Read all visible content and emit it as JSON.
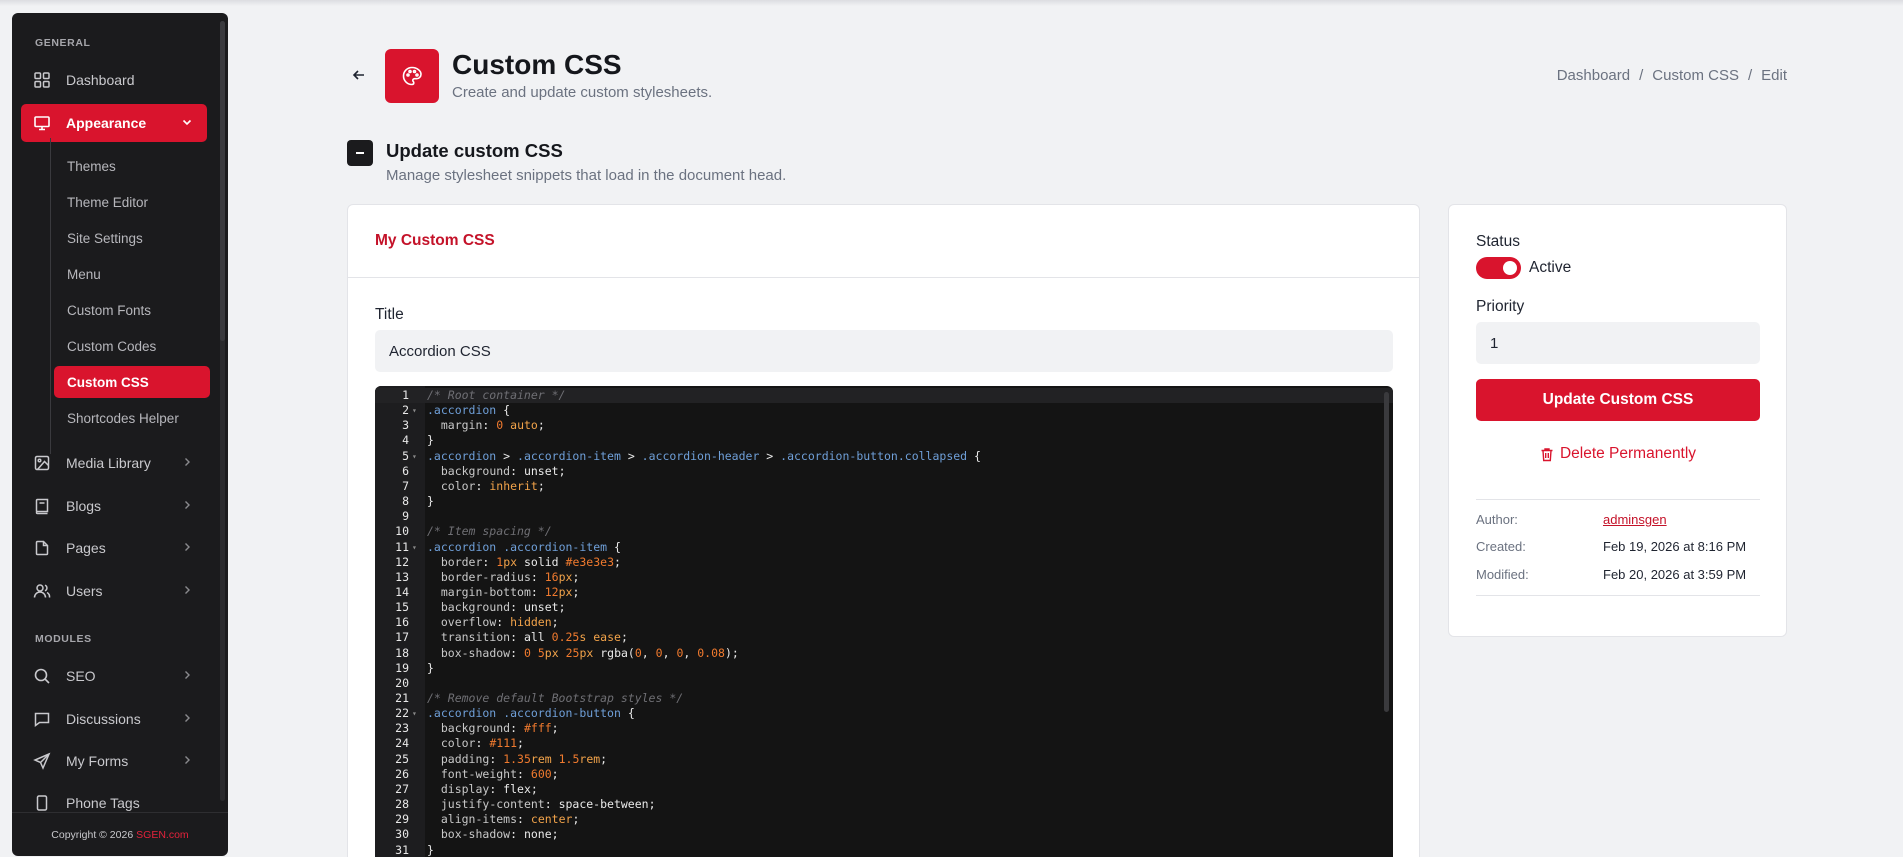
{
  "sidebar": {
    "general_label": "GENERAL",
    "modules_label": "MODULES",
    "items": [
      {
        "label": "Dashboard"
      },
      {
        "label": "Appearance"
      },
      {
        "label": "Media Library"
      },
      {
        "label": "Blogs"
      },
      {
        "label": "Pages"
      },
      {
        "label": "Users"
      },
      {
        "label": "SEO"
      },
      {
        "label": "Discussions"
      },
      {
        "label": "My Forms"
      },
      {
        "label": "Phone Tags"
      }
    ],
    "sub_items": [
      {
        "label": "Themes"
      },
      {
        "label": "Theme Editor"
      },
      {
        "label": "Site Settings"
      },
      {
        "label": "Menu"
      },
      {
        "label": "Custom Fonts"
      },
      {
        "label": "Custom Codes"
      },
      {
        "label": "Custom CSS"
      },
      {
        "label": "Shortcodes Helper"
      }
    ],
    "copyright_text": "Copyright © 2026",
    "copyright_brand": "SGEN.com"
  },
  "header": {
    "title": "Custom CSS",
    "subtitle": "Create and update custom stylesheets.",
    "breadcrumb": [
      "Dashboard",
      "/",
      "Custom CSS",
      "/",
      "Edit"
    ]
  },
  "section": {
    "title": "Update custom CSS",
    "subtitle": "Manage stylesheet snippets that load in the document head."
  },
  "card": {
    "tab_label": "My Custom CSS",
    "title_label": "Title",
    "title_value": "Accordion CSS"
  },
  "editor": {
    "lines": [
      "/* Root container */",
      ".accordion {",
      "  margin: 0 auto;",
      "}",
      ".accordion > .accordion-item > .accordion-header > .accordion-button.collapsed {",
      "  background: unset;",
      "  color: inherit;",
      "}",
      "",
      "/* Item spacing */",
      ".accordion .accordion-item {",
      "  border: 1px solid #e3e3e3;",
      "  border-radius: 16px;",
      "  margin-bottom: 12px;",
      "  background: unset;",
      "  overflow: hidden;",
      "  transition: all 0.25s ease;",
      "  box-shadow: 0 5px 25px rgba(0, 0, 0, 0.08);",
      "}",
      "",
      "/* Remove default Bootstrap styles */",
      ".accordion .accordion-button {",
      "  background: #fff;",
      "  color: #111;",
      "  padding: 1.35rem 1.5rem;",
      "  font-weight: 600;",
      "  display: flex;",
      "  justify-content: space-between;",
      "  align-items: center;",
      "  box-shadow: none;",
      "}",
      ""
    ]
  },
  "side": {
    "status_label": "Status",
    "status_value": "Active",
    "priority_label": "Priority",
    "priority_value": "1",
    "update_label": "Update Custom CSS",
    "delete_label": "Delete Permanently",
    "meta": [
      {
        "key": "Author:",
        "value": "adminsgen"
      },
      {
        "key": "Created:",
        "value": "Feb 19, 2026 at 8:16 PM"
      },
      {
        "key": "Modified:",
        "value": "Feb 20, 2026 at 3:59 PM"
      }
    ]
  },
  "colors": {
    "accent": "#d9142d",
    "sidebar_bg": "#1b1b1d",
    "page_bg": "#f1f2f4"
  }
}
